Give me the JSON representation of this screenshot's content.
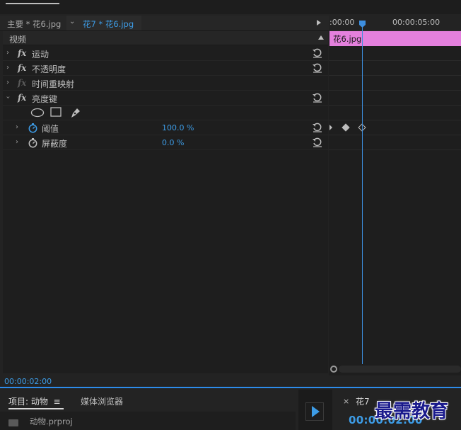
{
  "header": {
    "source_tab": "主要 * 花6.jpg",
    "sequence_clip": "花7 * 花6.jpg"
  },
  "effects": {
    "section_label": "视频",
    "items": [
      {
        "label": "运动"
      },
      {
        "label": "不透明度"
      },
      {
        "label": "时间重映射"
      },
      {
        "label": "亮度键"
      }
    ],
    "properties": [
      {
        "label": "阈值",
        "value": "100.0 %"
      },
      {
        "label": "屏蔽度",
        "value": "0.0 %"
      }
    ]
  },
  "timeline": {
    "tc_start": ":00:00",
    "tc_mid": "00:00:05:00",
    "clip_label": "花6.jpg"
  },
  "status": {
    "current_time": "00:00:02:00"
  },
  "project": {
    "tab_label": "项目: 动物",
    "media_browser": "媒体浏览器",
    "file": "动物.prproj"
  },
  "sequence": {
    "close": "×",
    "tab_label": "花7",
    "time": "00:00:02:00"
  },
  "watermark": "最需教育",
  "colors": {
    "accent_blue": "#3d9ce6",
    "clip_pink": "#e480dd",
    "panel_bg": "#1e1e1e"
  }
}
